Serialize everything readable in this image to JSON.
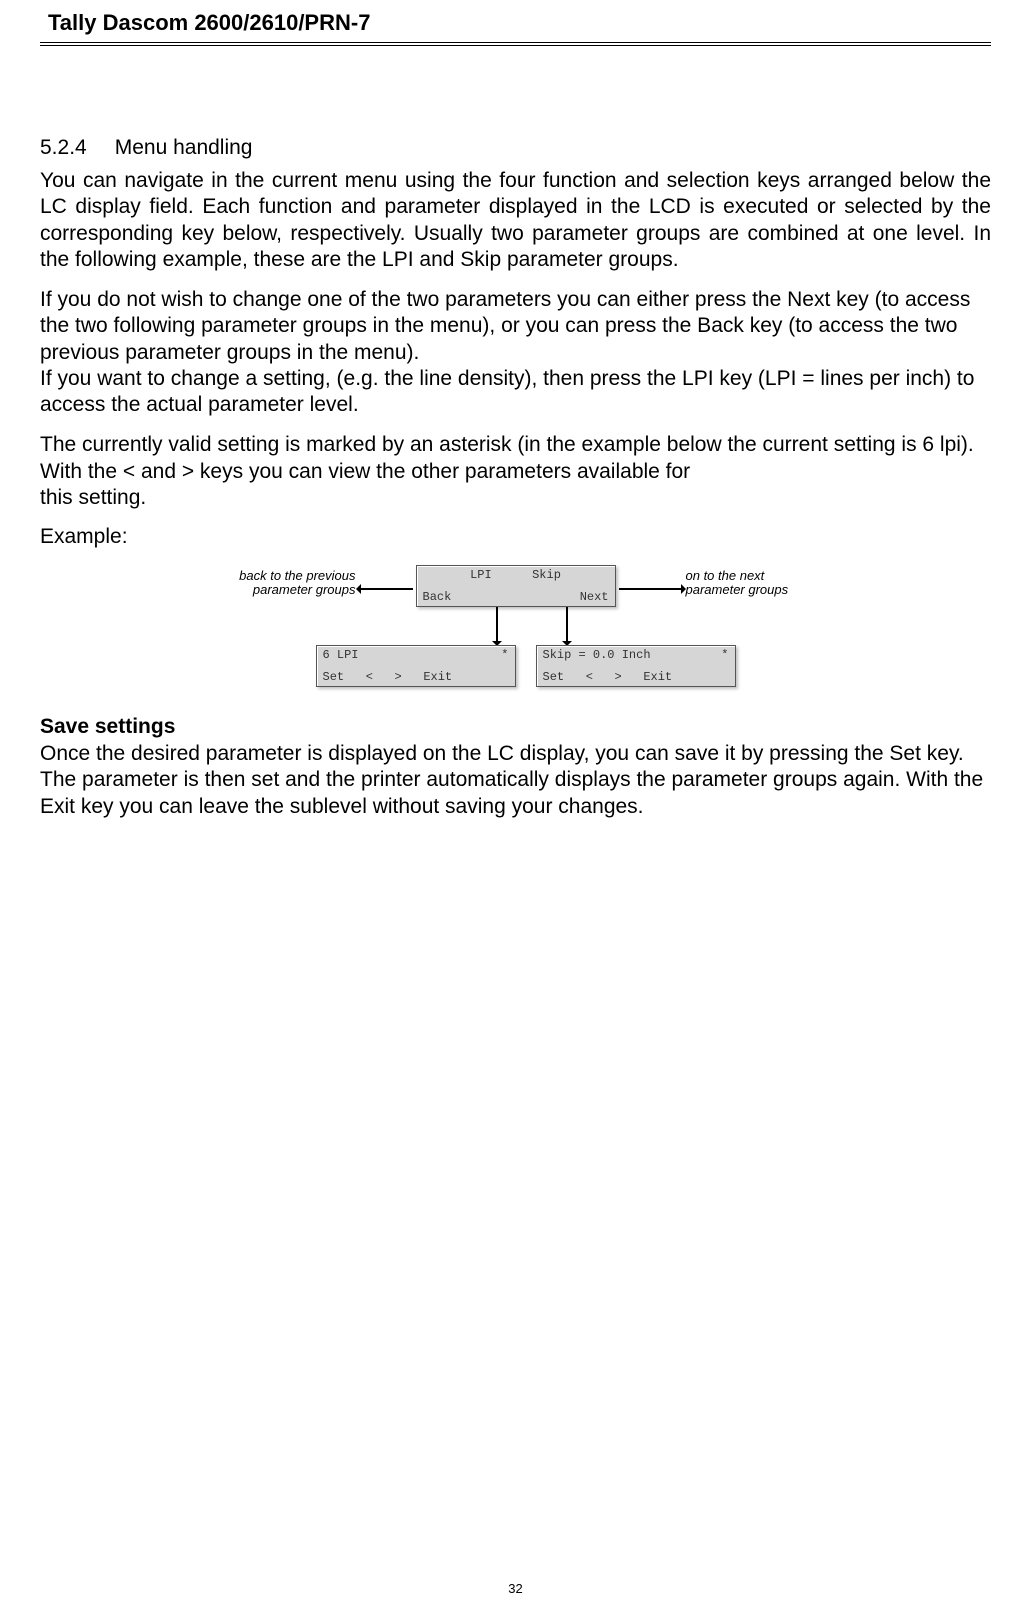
{
  "header": {
    "title": "Tally Dascom 2600/2610/PRN-7"
  },
  "section": {
    "number": "5.2.4",
    "title": "Menu handling"
  },
  "paragraphs": {
    "p1": "You can navigate in the current menu using the four function and selection keys arranged below the LC display field. Each function and parameter displayed in the LCD is executed or selected by the corresponding key below, respectively. Usually two parameter groups are combined at one level. In the following example, these are the LPI and Skip parameter groups.",
    "p2": "If you do not wish to change one of the two parameters you can either press the Next key (to access the two following parameter groups in the menu), or you can press the Back key (to access the two previous parameter groups in the menu).",
    "p3": "If you want to change a setting, (e.g. the line density), then press the LPI key (LPI = lines per inch) to access the actual parameter level.",
    "p4": "The currently valid setting is marked by an asterisk (in the example below the current setting is 6 lpi). With the < and > keys you can view the other parameters available for",
    "p4b": "this setting.",
    "example_label": "Example:"
  },
  "diagram": {
    "caption_left": "back to the previous parameter groups",
    "caption_right": "on to the next parameter groups",
    "lcd_top": {
      "row1_left": "",
      "row1_mid1": "LPI",
      "row1_mid2": "Skip",
      "row1_right": "",
      "row2_left": "Back",
      "row2_right": "Next"
    },
    "lcd_left": {
      "row1_left": "6 LPI",
      "row1_right": "*",
      "row2": "Set   <   >   Exit"
    },
    "lcd_right": {
      "row1_left": "Skip = 0.0 Inch",
      "row1_right": "*",
      "row2": "Set   <   >   Exit"
    }
  },
  "save": {
    "heading": "Save settings",
    "body": "Once the desired parameter is displayed on the LC display, you can save it by pressing the Set key. The parameter is then set and the printer automatically displays the parameter groups again. With the Exit key you can leave the sublevel without saving your changes."
  },
  "page_number": "32"
}
